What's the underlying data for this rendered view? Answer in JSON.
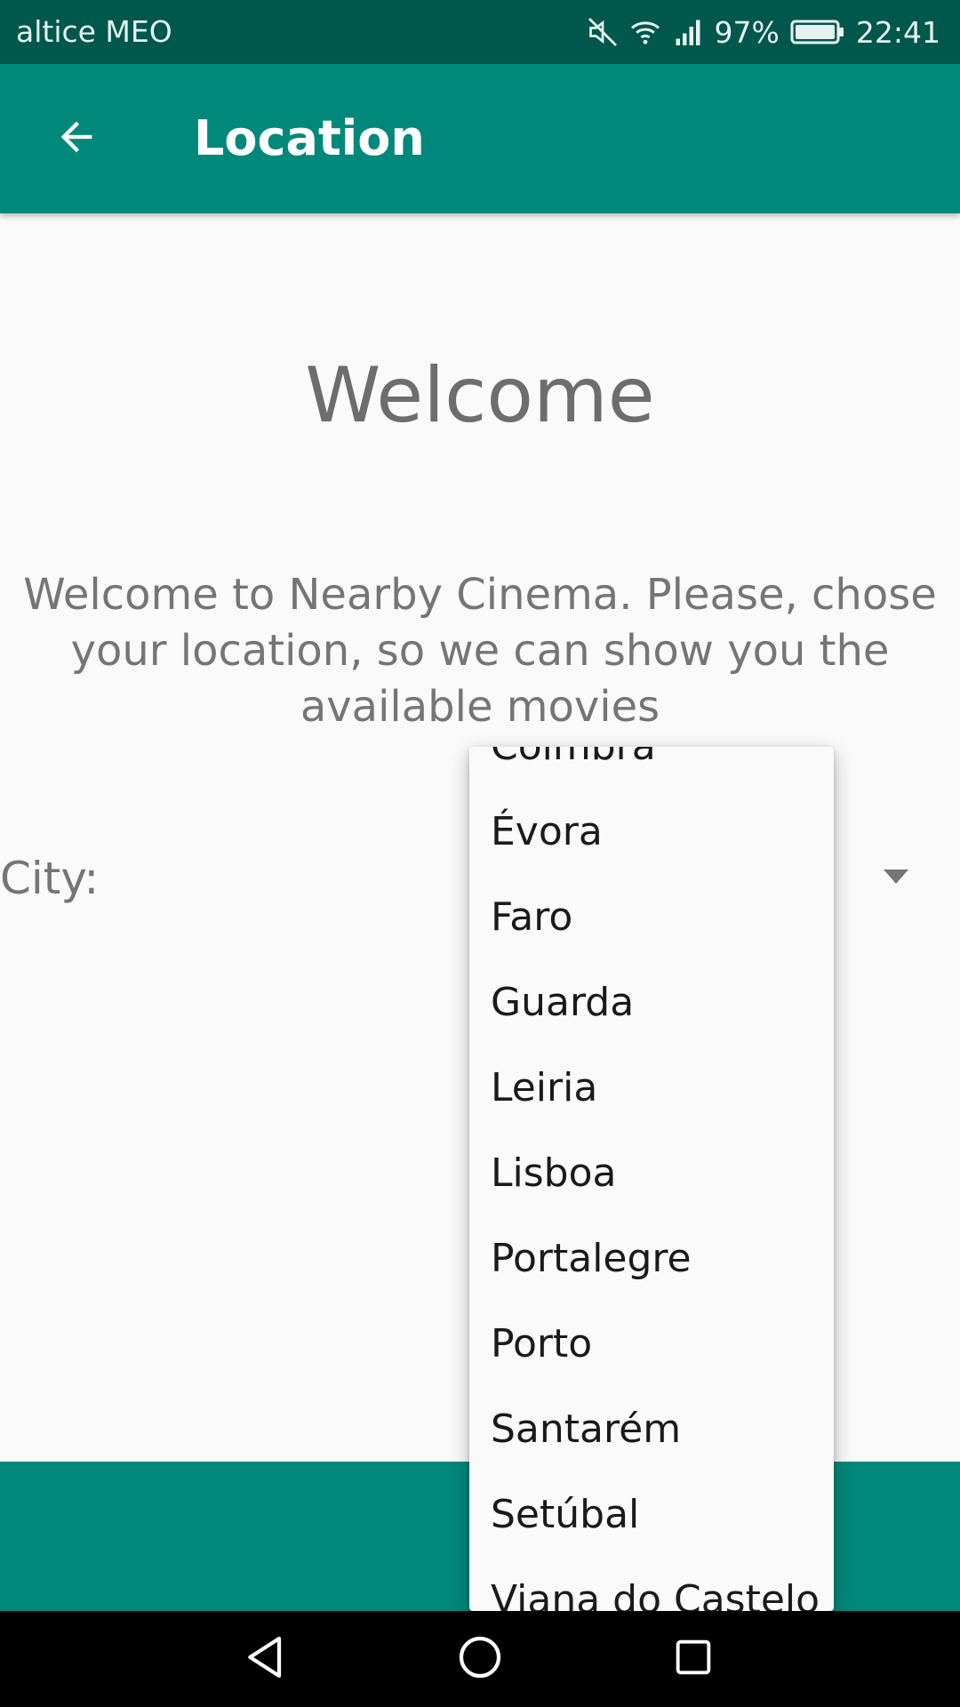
{
  "status_bar": {
    "carrier": "altice MEO",
    "battery": "97%",
    "time": "22:41",
    "icons": [
      "mute-icon",
      "wifi-icon",
      "signal-icon",
      "battery-icon"
    ]
  },
  "app_bar": {
    "title": "Location",
    "back_icon": "arrow-back-icon"
  },
  "main": {
    "title": "Welcome",
    "text": "Welcome to Nearby Cinema. Please, chose your location, so we can show you the available movies",
    "city_label": "City:"
  },
  "dropdown": {
    "items": [
      "Coimbra",
      "Évora",
      "Faro",
      "Guarda",
      "Leiria",
      "Lisboa",
      "Portalegre",
      "Porto",
      "Santarém",
      "Setúbal",
      "Viana do Castelo"
    ]
  },
  "colors": {
    "primary": "#00897b",
    "primary_dark": "#00574b",
    "background": "#fafafa",
    "text_secondary": "#757575"
  }
}
